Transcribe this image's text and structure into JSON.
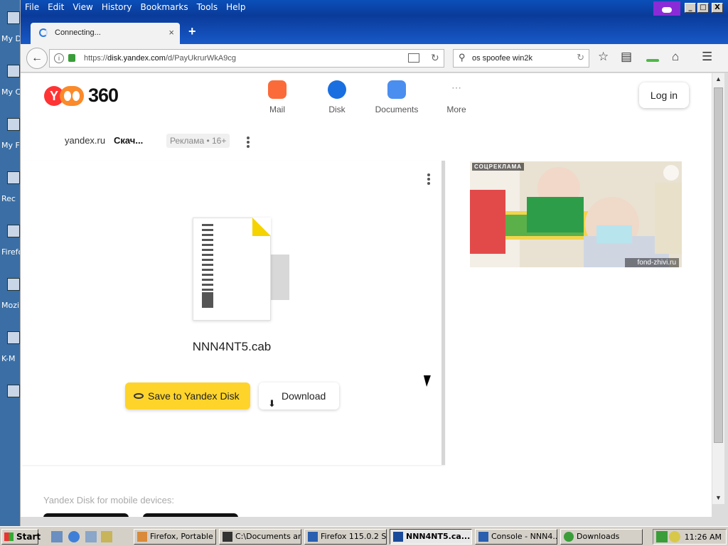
{
  "desktop": {
    "icons": [
      "My D",
      "My C",
      "My\nF",
      "Rec",
      "Firefo",
      "Mozi",
      "K-M",
      ""
    ]
  },
  "window": {
    "menu": [
      "File",
      "Edit",
      "View",
      "History",
      "Bookmarks",
      "Tools",
      "Help"
    ],
    "controls": {
      "minimize": "_",
      "maximize": "□",
      "close": "X"
    }
  },
  "tab": {
    "title": "Connecting...",
    "close": "×",
    "new_tab": "+"
  },
  "nav": {
    "url_host": "disk.yandex.com",
    "url_prefix": "https://",
    "url_path": "/d/PayUkrurWkA9cg",
    "search_query": "os spoofee win2k"
  },
  "site": {
    "logo_number": "360",
    "services": [
      {
        "label": "Mail",
        "color": "#fb6b3a"
      },
      {
        "label": "Disk",
        "color": "#1a6fe0"
      },
      {
        "label": "Documents",
        "color": "#4a8ef0"
      },
      {
        "label": "More",
        "color": "#ffffff"
      }
    ],
    "login": "Log in",
    "ad_domain": "yandex.ru",
    "ad_title": "Скач...",
    "ad_badge": "Реклама • 16+",
    "file_name": "NNN4NT5.cab",
    "save_button": "Save to Yandex Disk",
    "download_button": "Download",
    "side_ad_tag": "СОЦРЕКЛАМА",
    "side_ad_source": "fond-zhivi.ru",
    "mobile_label": "Yandex Disk for mobile devices:"
  },
  "taskbar": {
    "start": "Start",
    "items": [
      {
        "label": "Firefox, Portable ...",
        "active": false
      },
      {
        "label": "C:\\Documents an...",
        "active": false
      },
      {
        "label": "Firefox 115.0.2 S...",
        "active": false
      },
      {
        "label": "NNN4NT5.ca...",
        "active": true
      },
      {
        "label": "Console - NNN4...",
        "active": false
      },
      {
        "label": "Downloads",
        "active": false
      }
    ],
    "clock": "11:26 AM"
  }
}
